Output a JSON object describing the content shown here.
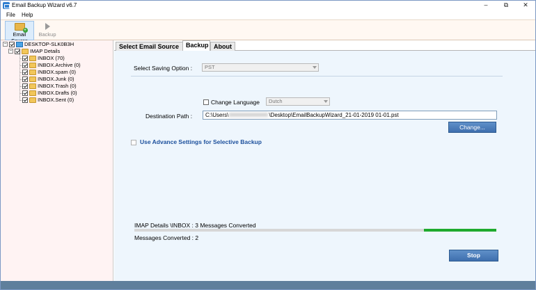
{
  "window": {
    "title": "Email Backup Wizard v6.7",
    "controls": {
      "minimize": "–",
      "maximize": "⧉",
      "close": "✕"
    }
  },
  "menu": {
    "file": "File",
    "help": "Help"
  },
  "toolbar": {
    "email_source": {
      "label": "Email Source",
      "icon": "folder-add-icon"
    },
    "backup": {
      "label": "Backup",
      "icon": "play-icon",
      "enabled": false
    }
  },
  "tree": {
    "root": "DESKTOP-SLK0B3H",
    "account": "IMAP Details",
    "folders": [
      {
        "label": "INBOX (70)"
      },
      {
        "label": "INBOX.Archive (0)"
      },
      {
        "label": "INBOX.spam (0)"
      },
      {
        "label": "INBOX.Junk (0)"
      },
      {
        "label": "INBOX.Trash (0)"
      },
      {
        "label": "INBOX.Drafts (0)"
      },
      {
        "label": "INBOX.Sent (0)"
      }
    ]
  },
  "tabs": [
    {
      "label": "Select Email Source",
      "active": false
    },
    {
      "label": "Backup",
      "active": true
    },
    {
      "label": "About",
      "active": false
    }
  ],
  "backup": {
    "saving_option_label": "Select Saving Option :",
    "saving_option_value": "PST",
    "change_language_label": "Change Language",
    "language_value": "Dutch",
    "destination_label": "Destination Path :",
    "path_prefix": "C:\\Users\\",
    "path_suffix": "\\Desktop\\EmailBackupWizard_21-01-2019 01-01.pst",
    "change_button": "Change...",
    "advance_settings_label": "Use Advance Settings for Selective Backup",
    "progress_status": "IMAP Details \\INBOX : 3 Messages Converted",
    "progress_fraction": 0.8,
    "messages_converted": "Messages Converted : 2",
    "stop_button": "Stop"
  },
  "colors": {
    "accent": "#3f6fae",
    "progress": "#1faa2e",
    "link": "#1b4f9c",
    "statusbar": "#5f7f9c"
  }
}
